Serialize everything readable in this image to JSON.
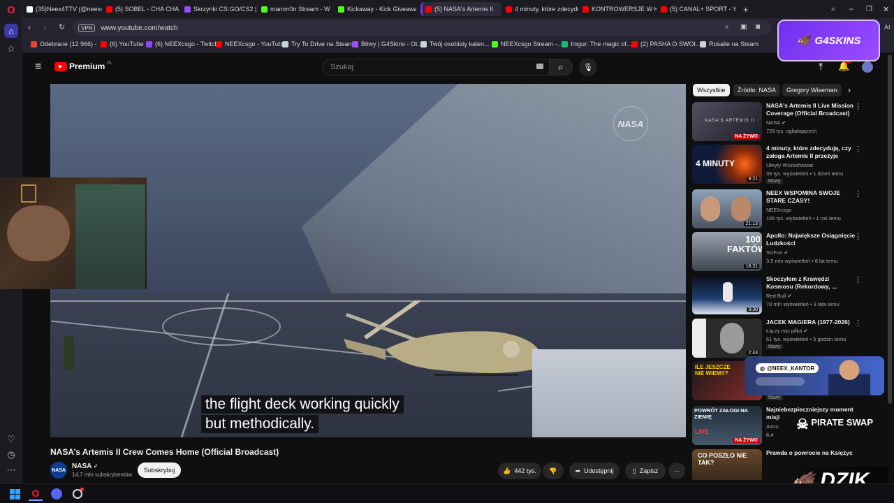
{
  "browser": {
    "tabs": [
      {
        "label": "(35)Neex4TTV (@neex4ttv",
        "color": "#ffffff"
      },
      {
        "label": "(5) SOBEL - CHA CHA",
        "color": "#ff0000"
      },
      {
        "label": "Skrzynki CS:GO/CS2 | G4S",
        "color": "#9b4dff"
      },
      {
        "label": "mamm0n Stream - W",
        "color": "#53fc18"
      },
      {
        "label": "Kickaway - Kick Giveaway",
        "color": "#53fc18"
      },
      {
        "label": "(5) NASA's Artemis II",
        "color": "#ff0000"
      },
      {
        "label": "4 minuty, które zdecyduj",
        "color": "#ff0000"
      },
      {
        "label": "KONTROWERSJE W KOŃC",
        "color": "#ff0000"
      },
      {
        "label": "(5) CANAL+ SPORT - YouT",
        "color": "#ff0000"
      }
    ],
    "new_tab": "+",
    "url": "www.youtube.com/watch",
    "vpn_label": "VPN",
    "bookmarks": [
      {
        "label": "Odebrane (12 966) -",
        "color": "#ea4335"
      },
      {
        "label": "(6) YouTube",
        "color": "#ff0000"
      },
      {
        "label": "(6) NEEXcsgo - Twitch",
        "color": "#9146ff"
      },
      {
        "label": "NEEXcsgo - YouTube",
        "color": "#ff0000"
      },
      {
        "label": "Try To Drive na Steam",
        "color": "#c7d5e0"
      },
      {
        "label": "Bitwy | G4Skins - Ot...",
        "color": "#9b4dff"
      },
      {
        "label": "Twój osobisty kalen...",
        "color": "#c7d5e0"
      },
      {
        "label": "NEEXcsgo Stream -...",
        "color": "#53fc18"
      },
      {
        "label": "Imgur: The magic of...",
        "color": "#1bb76e"
      },
      {
        "label": "(2) PASHA O SWOI...",
        "color": "#ff0000"
      },
      {
        "label": "Rosalie na Steam",
        "color": "#c7d5e0"
      }
    ]
  },
  "youtube": {
    "logo_text": "Premium",
    "logo_sup": "PL",
    "search_placeholder": "Szukaj",
    "notif_count": "9+",
    "video": {
      "title": "NASA’s Artemis II Crew Comes Home (Official Broadcast)",
      "subtitle_lines": [
        "the flight deck working quickly",
        "but methodically."
      ],
      "watermark": "NASA"
    },
    "channel": {
      "name": "NASA",
      "subs": "14,7 mln subskrybentów",
      "subscribe": "Subskrybuj"
    },
    "actions": {
      "likes": "442 tys.",
      "share": "Udostępnij",
      "save": "Zapisz"
    },
    "chips": [
      "Wszystkie",
      "Źródło: NASA",
      "Gregory Wiseman"
    ],
    "recommended": [
      {
        "title": "NASA's Artemis II Live Mission Coverage (Official Broadcast)",
        "channel": "NASA",
        "meta": "728 tys. oglądających",
        "badge": "",
        "dur": "",
        "live": "NA ŻYWO",
        "thumb": "#3a3a48"
      },
      {
        "title": "4 minuty, które zdecydują, czy załoga Artemis II przeżyje",
        "channel": "Ukryty Wszechświat",
        "meta": "35 tys. wyświetleń • 1 dzień temu",
        "badge": "Nowy",
        "dur": "9:21",
        "live": "",
        "thumb": "#1a2a55"
      },
      {
        "title": "NEEX WSPOMINA SWOJE STARE CZASY!",
        "channel": "NEEXcsgo",
        "meta": "105 tys. wyświetleń • 1 rok temu",
        "badge": "",
        "dur": "21:13",
        "live": "",
        "thumb": "#6f7c8e"
      },
      {
        "title": "Apollo: Największe Osiągnięcie Ludzkości",
        "channel": "SciFun",
        "meta": "3,5 mln wyświetleń • 8 lat temu",
        "badge": "",
        "dur": "16:31",
        "live": "",
        "thumb": "#4e5866"
      },
      {
        "title": "Skoczyłem z Krawędzi Kosmosu (Rekordowy, ...",
        "channel": "Red Bull",
        "meta": "70 mln wyświetleń • 3 lata temu",
        "badge": "",
        "dur": "3:30",
        "live": "",
        "thumb": "#1f3c6a"
      },
      {
        "title": "JACEK MAGIERA (1977-2026)",
        "channel": "Łączy nas piłka",
        "meta": "61 tys. wyświetleń • 5 godzin temu",
        "badge": "Nowy",
        "dur": "2:43",
        "live": "",
        "thumb": "#2d2d2d"
      },
      {
        "title": "",
        "channel": "",
        "meta": "",
        "badge": "Nowy",
        "dur": "",
        "live": "",
        "thumb": "#8b2a2a"
      },
      {
        "title": "Najniebezpieczniejszy moment misji",
        "channel": "Astro",
        "meta": "6,4",
        "badge": "",
        "dur": "",
        "live": "NA ŻYWO",
        "thumb": "#2c3b4c"
      },
      {
        "title": "Prawda o powrocie na Księżyc",
        "channel": "",
        "meta": "",
        "badge": "",
        "dur": "",
        "live": "",
        "thumb": "#3b3024"
      }
    ],
    "thumb_texts": {
      "rec0": "NASA'S ARTEMIS II",
      "rec1": "4 MINUTY",
      "rec3": "100 FAKTÓW",
      "rec6": "ILE JESZCZE NIE WIEMY?",
      "rec7": "POWRÓT ZAŁOGI NA ZIEMIĘ",
      "rec7b": "LIVE",
      "rec8": "CO POSZŁO NIE TAK?"
    }
  },
  "overlays": {
    "g4skins": "G4SKINS",
    "instagram": "@NEEX_KANTOR",
    "pirate": "PIRATE SWAP",
    "dzik": "DZIK"
  },
  "colors": {
    "opera_red": "#ff1b2d",
    "yt_red": "#ff0000",
    "accent_purple": "#7b2ff7"
  }
}
